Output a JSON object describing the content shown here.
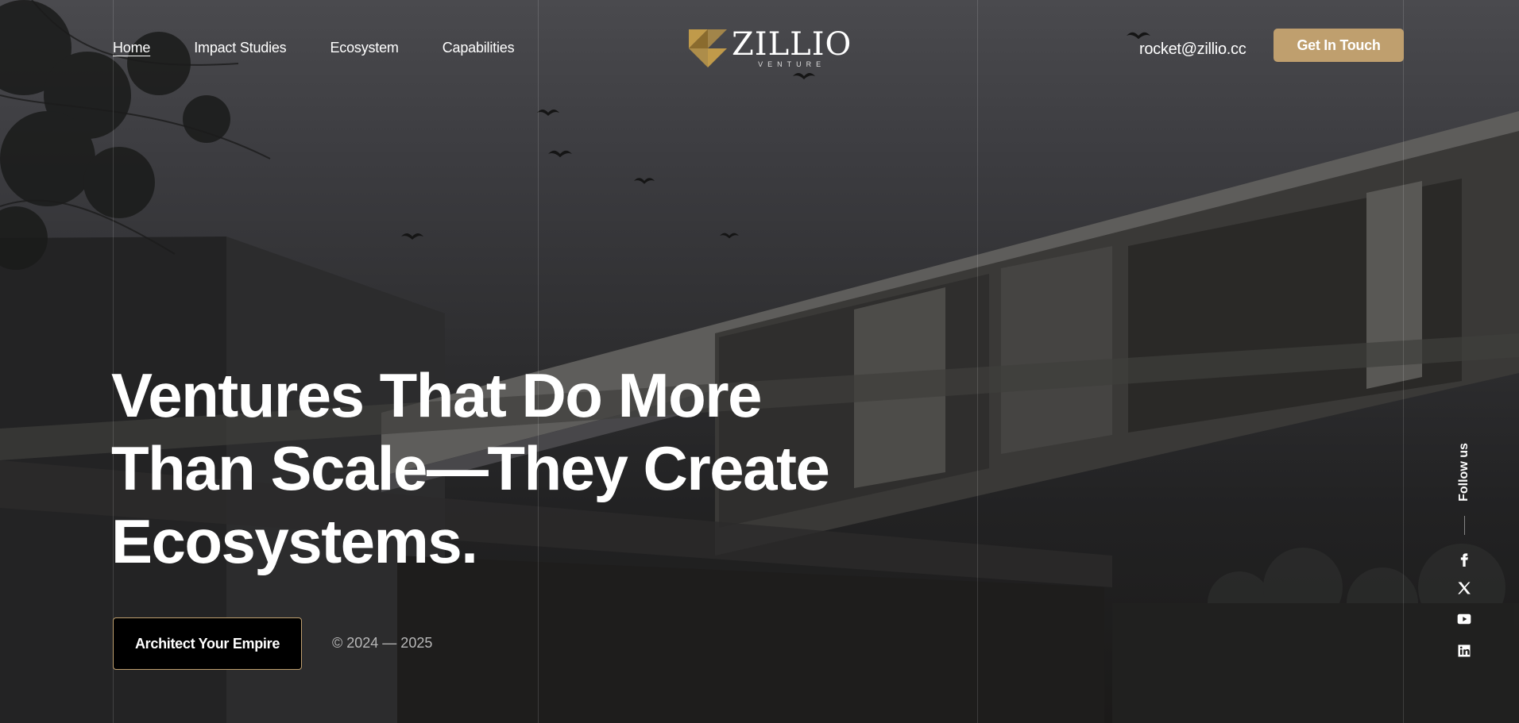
{
  "nav": {
    "items": [
      {
        "label": "Home",
        "active": true
      },
      {
        "label": "Impact Studies"
      },
      {
        "label": "Ecosystem"
      },
      {
        "label": "Capabilities"
      }
    ]
  },
  "logo": {
    "word": "ZILLIO",
    "sub": "VENTURE",
    "mark_color": "#c09a4a"
  },
  "header": {
    "email": "rocket@zillio.cc",
    "cta_label": "Get In Touch"
  },
  "hero": {
    "title_lines": [
      "Ventures That Do More",
      "Than Scale—They Create",
      "Ecosystems."
    ],
    "cta_label": "Architect Your Empire",
    "copyright": "© 2024 — 2025"
  },
  "social": {
    "follow_label": "Follow us",
    "icons": [
      "facebook-icon",
      "x-icon",
      "youtube-icon",
      "linkedin-icon"
    ]
  },
  "colors": {
    "accent": "#bf9f6e",
    "cta_dark": "#000000"
  }
}
